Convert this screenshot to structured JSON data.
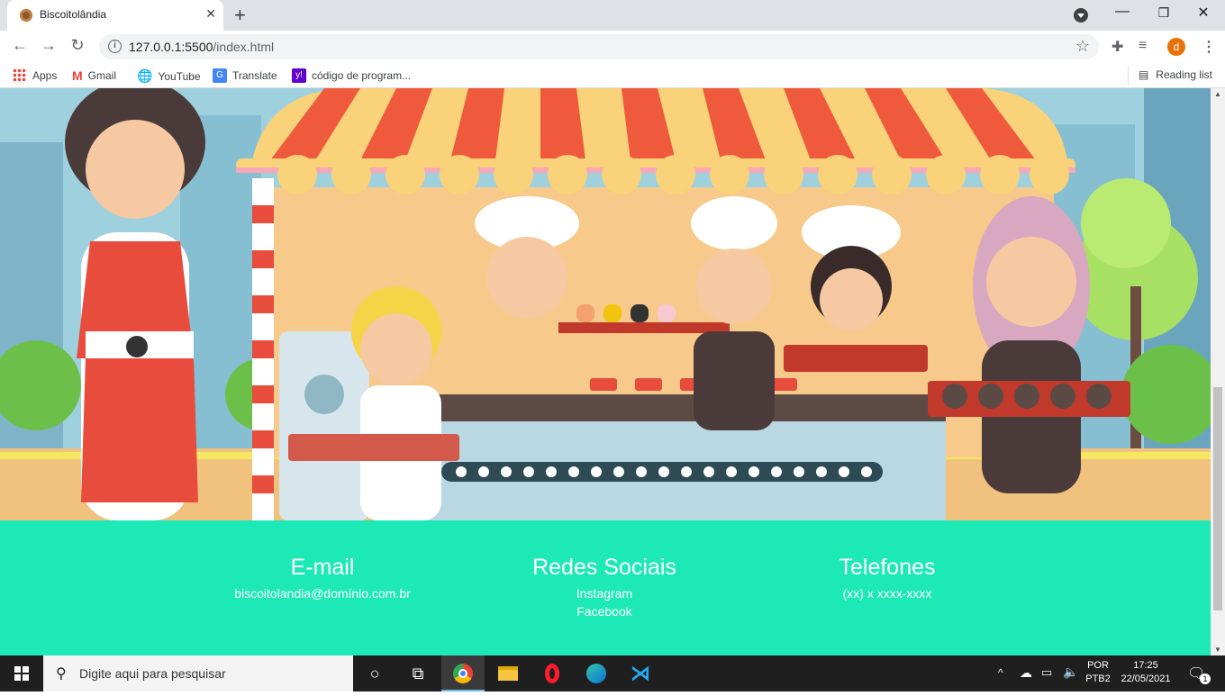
{
  "browser": {
    "tab_title": "Biscoitolândia",
    "url_host": "127.0.0.1:5500",
    "url_path": "/index.html",
    "bookmarks": [
      "Apps",
      "Gmail",
      "YouTube",
      "Translate",
      "código de program..."
    ],
    "reading_list": "Reading list",
    "avatar_letter": "d"
  },
  "footer": {
    "email": {
      "title": "E-mail",
      "value": "biscoitolandia@domínio.com.br"
    },
    "social": {
      "title": "Redes Sociais",
      "links": [
        "Instagram",
        "Facebook"
      ]
    },
    "phones": {
      "title": "Telefones",
      "value": "(xx) x xxxx-xxxx"
    }
  },
  "taskbar": {
    "search_placeholder": "Digite aqui para pesquisar",
    "lang_top": "POR",
    "lang_bottom": "PTB2",
    "time": "17:25",
    "date": "22/05/2021",
    "notifications": "1"
  },
  "colors": {
    "footer_bg": "#1de9b6",
    "footer_text": "#ffffff"
  }
}
